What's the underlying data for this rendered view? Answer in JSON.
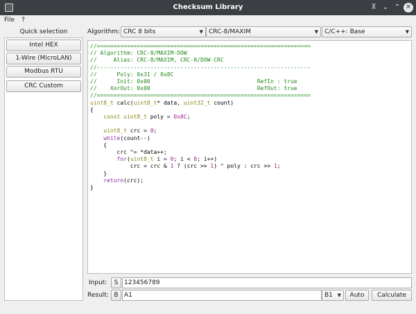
{
  "window": {
    "title": "Checksum Library",
    "controls": [
      "keep-above",
      "minimize",
      "maximize",
      "close"
    ]
  },
  "menu": [
    "File",
    "?"
  ],
  "quick_selection": {
    "label": "Quick selection",
    "presets": [
      "Intel HEX",
      "1-Wire (MicroLAN)",
      "Modbus RTU"
    ],
    "custom": "CRC Custom"
  },
  "algorithm": {
    "label": "Algorithm:",
    "family": "CRC 8 bits",
    "variant": "CRC-8/MAXIM",
    "language": "C/C++: Base"
  },
  "code_lines": [
    [
      [
        "cm",
        "//================================================================"
      ]
    ],
    [
      [
        "cm",
        "// Algorithm: CRC-8/MAXIM-DOW"
      ]
    ],
    [
      [
        "cm",
        "//     Alias: CRC-8/MAXIM, CRC-8/DOW-CRC"
      ]
    ],
    [
      [
        "cm",
        "//----------------------------------------------------------------"
      ]
    ],
    [
      [
        "cm",
        "//      Poly: 0x31 / 0x8C"
      ]
    ],
    [
      [
        "cm",
        "//      Init: 0x00                                RefIn : true"
      ]
    ],
    [
      [
        "cm",
        "//    XorOut: 0x00                                RefOut: true"
      ]
    ],
    [
      [
        "cm",
        "//================================================================"
      ]
    ],
    [
      [
        "ty",
        "uint8_t"
      ],
      [
        "tx",
        " calc("
      ],
      [
        "ty",
        "uint8_t"
      ],
      [
        "tx",
        "* data, "
      ],
      [
        "ty",
        "uint32_t"
      ],
      [
        "tx",
        " count)"
      ]
    ],
    [
      [
        "tx",
        "{"
      ]
    ],
    [
      [
        "tx",
        "    "
      ],
      [
        "ty",
        "const uint8_t"
      ],
      [
        "tx",
        " poly = "
      ],
      [
        "nm",
        "0x8C"
      ],
      [
        "tx",
        ";"
      ]
    ],
    [
      [
        "tx",
        ""
      ]
    ],
    [
      [
        "tx",
        "    "
      ],
      [
        "ty",
        "uint8_t"
      ],
      [
        "tx",
        " crc = "
      ],
      [
        "nm",
        "0"
      ],
      [
        "tx",
        ";"
      ]
    ],
    [
      [
        "tx",
        "    "
      ],
      [
        "kw",
        "while"
      ],
      [
        "tx",
        "(count--)"
      ]
    ],
    [
      [
        "tx",
        "    {"
      ]
    ],
    [
      [
        "tx",
        "        crc ^= *data++;"
      ]
    ],
    [
      [
        "tx",
        "        "
      ],
      [
        "kw",
        "for"
      ],
      [
        "tx",
        "("
      ],
      [
        "ty",
        "uint8_t"
      ],
      [
        "tx",
        " i = "
      ],
      [
        "nm",
        "0"
      ],
      [
        "tx",
        "; i < "
      ],
      [
        "nm",
        "8"
      ],
      [
        "tx",
        "; i++)"
      ]
    ],
    [
      [
        "tx",
        "            crc = crc & "
      ],
      [
        "nm",
        "1"
      ],
      [
        "tx",
        " ? (crc >> "
      ],
      [
        "nm",
        "1"
      ],
      [
        "tx",
        ") ^ poly : crc >> "
      ],
      [
        "nm",
        "1"
      ],
      [
        "tx",
        ";"
      ]
    ],
    [
      [
        "tx",
        "    }"
      ]
    ],
    [
      [
        "tx",
        "    "
      ],
      [
        "kw",
        "return"
      ],
      [
        "tx",
        "(crc);"
      ]
    ],
    [
      [
        "tx",
        "}"
      ]
    ]
  ],
  "input": {
    "label": "Input:",
    "mode": "S",
    "value": "123456789"
  },
  "result": {
    "label": "Result:",
    "mode": "B",
    "value": "A1",
    "format": "B1",
    "auto_label": "Auto",
    "calculate_label": "Calculate"
  }
}
